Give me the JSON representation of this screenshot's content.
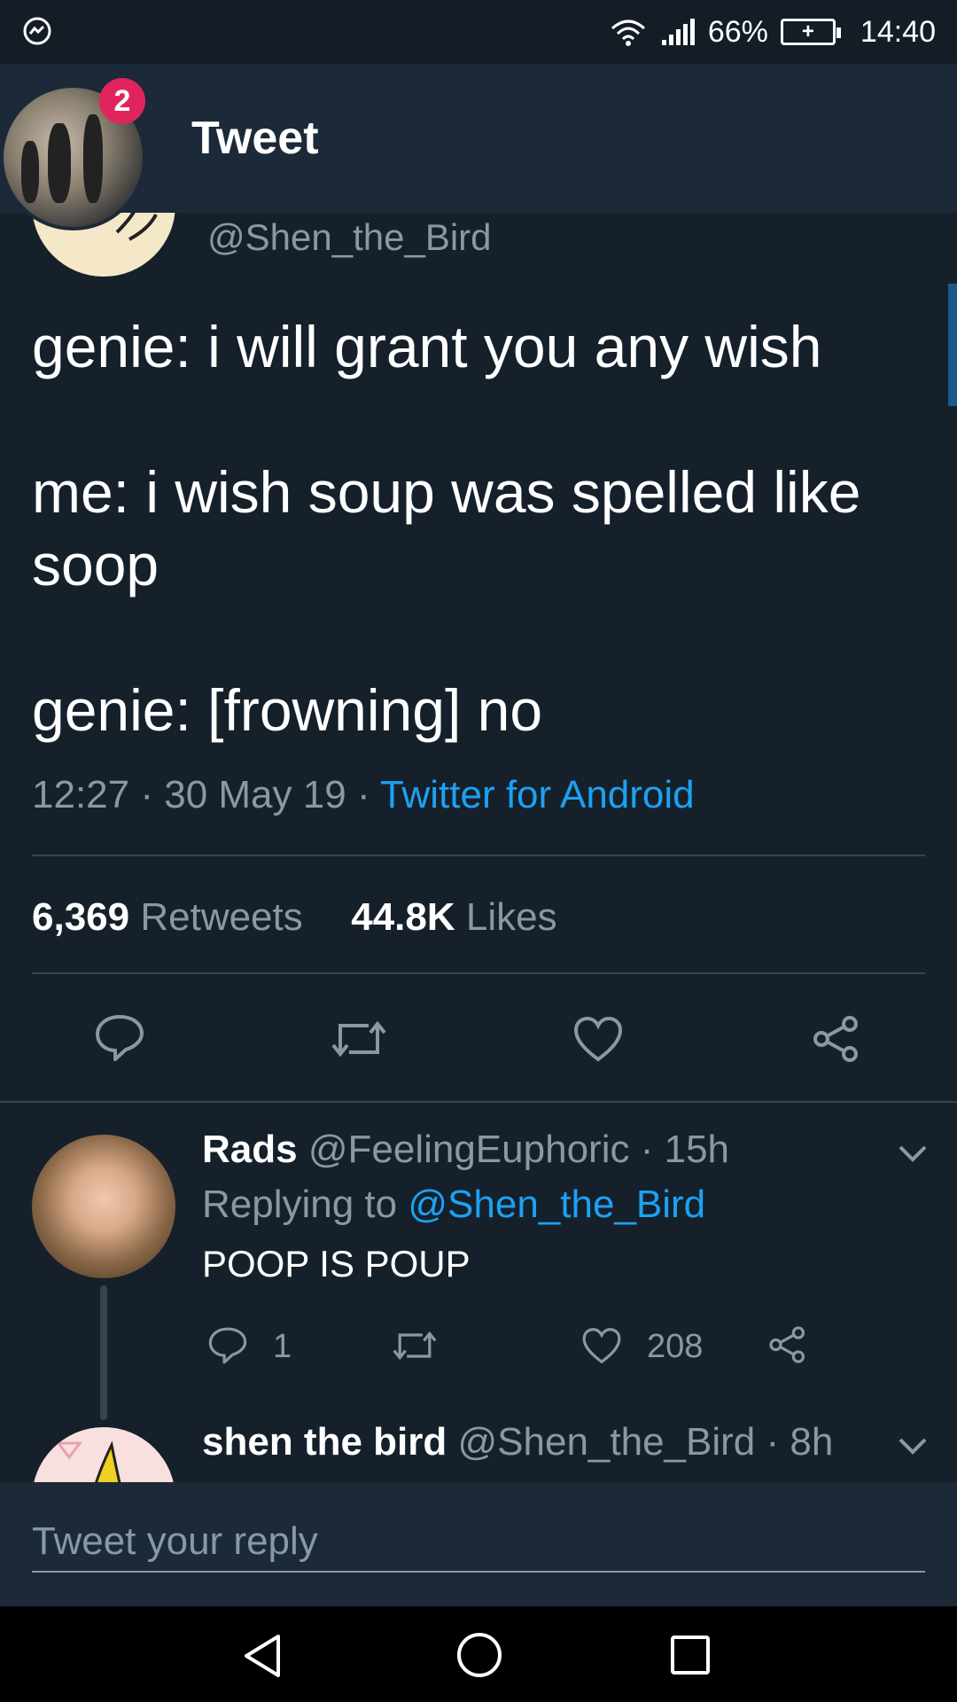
{
  "status_bar": {
    "battery_percent": "66%",
    "time": "14:40"
  },
  "header": {
    "title": "Tweet",
    "notification_count": "2"
  },
  "tweet": {
    "handle": "@Shen_the_Bird",
    "text": "genie: i will grant you any wish\n\nme: i wish soup was spelled like soop\n\ngenie: [frowning] no",
    "time": "12:27",
    "date": "30 May 19",
    "source": "Twitter for Android",
    "retweets_count": "6,369",
    "retweets_label": "Retweets",
    "likes_count": "44.8K",
    "likes_label": "Likes"
  },
  "reply": {
    "name": "Rads",
    "handle": "@FeelingEuphoric",
    "age": "15h",
    "replying_to_label": "Replying to",
    "replying_to_handle": "@Shen_the_Bird",
    "text": "POOP IS POUP",
    "reply_count": "1",
    "like_count": "208"
  },
  "next_reply": {
    "name": "shen the bird",
    "handle": "@Shen_the_Bird",
    "age": "8h"
  },
  "compose": {
    "placeholder": "Tweet your reply"
  },
  "colors": {
    "background": "#15202b",
    "header": "#1c2938",
    "accent": "#1da1f2",
    "muted": "#8899a6",
    "badge": "#e0245e"
  }
}
